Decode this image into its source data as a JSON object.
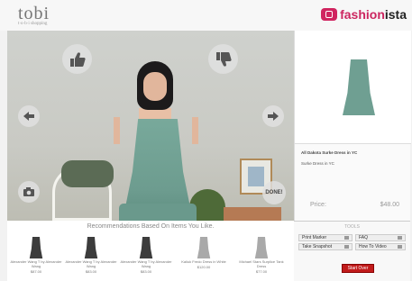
{
  "header": {
    "logo": "tobi",
    "logo_tagline": "t·o·b·i shopping",
    "partner_name_a": "fashion",
    "partner_name_b": "ista"
  },
  "video": {
    "like_icon": "thumbs-up-icon",
    "dislike_icon": "thumbs-down-icon",
    "prev_icon": "arrow-left-icon",
    "next_icon": "arrow-right-icon",
    "snapshot_icon": "camera-icon",
    "done_label": "DONE!"
  },
  "product": {
    "name": "All Dakota Surke Dress in YC",
    "description": "Surke Dress in YC",
    "price_label": "Price:",
    "price_value": "$48.00"
  },
  "recommendations": {
    "title": "Recommendations Based On Items You Like.",
    "items": [
      {
        "name": "Alexander Wang T by Alexander Wang",
        "price": "$87.00"
      },
      {
        "name": "Alexander Wang T by Alexander Wang",
        "price": "$83.00"
      },
      {
        "name": "Alexander Wang T by Alexander Wang",
        "price": "$83.00"
      },
      {
        "name": "Kaliuk Fredo Dress in White",
        "price": "$120.00"
      },
      {
        "name": "Michael Stars Surplice Tank Dress",
        "price": "$77.00"
      }
    ]
  },
  "tools": {
    "title": "TOOLS",
    "print_marker": "Print Marker",
    "faq": "FAQ",
    "take_snapshot": "Take Snapshot",
    "how_to_video": "How To Video",
    "start_over": "Start Over"
  },
  "colors": {
    "brand_pink": "#cc2660",
    "start_over_red": "#c11b1b",
    "dress_teal": "#6f9f92"
  }
}
